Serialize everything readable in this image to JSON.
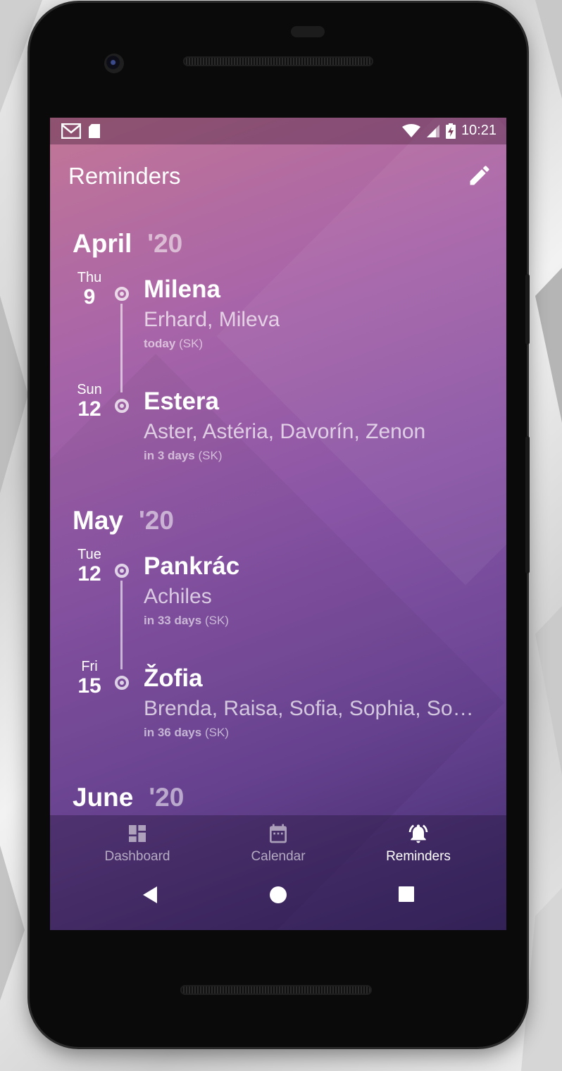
{
  "statusbar": {
    "time": "10:21",
    "left_icons": [
      "gmail-icon",
      "sd-card-icon"
    ],
    "right_icons": [
      "wifi-icon",
      "signal-icon",
      "battery-charging-icon"
    ]
  },
  "appbar": {
    "title": "Reminders",
    "action_icon": "edit-pencil-icon"
  },
  "months": [
    {
      "name": "April",
      "year": "'20",
      "entries": [
        {
          "dow": "Thu",
          "day": "9",
          "name": "Milena",
          "others": "Erhard, Mileva",
          "when_bold": "today",
          "when_suffix": " (SK)"
        },
        {
          "dow": "Sun",
          "day": "12",
          "name": "Estera",
          "others": "Aster, Astéria, Davorín, Zenon",
          "when_bold": "in 3 days",
          "when_suffix": " (SK)"
        }
      ]
    },
    {
      "name": "May",
      "year": "'20",
      "entries": [
        {
          "dow": "Tue",
          "day": "12",
          "name": "Pankrác",
          "others": "Achiles",
          "when_bold": "in 33 days",
          "when_suffix": " (SK)"
        },
        {
          "dow": "Fri",
          "day": "15",
          "name": "Žofia",
          "others": "Brenda, Raisa, Sofia, Sophia, Sop…",
          "when_bold": "in 36 days",
          "when_suffix": " (SK)"
        }
      ]
    },
    {
      "name": "June",
      "year": "'20",
      "entries": []
    }
  ],
  "bottom_nav": {
    "items": [
      {
        "label": "Dashboard",
        "icon": "dashboard-icon",
        "active": false
      },
      {
        "label": "Calendar",
        "icon": "calendar-icon",
        "active": false
      },
      {
        "label": "Reminders",
        "icon": "bell-ringing-icon",
        "active": true
      }
    ]
  },
  "system_nav": [
    "back-icon",
    "home-icon",
    "recents-icon"
  ],
  "colors": {
    "gradient_top": "#c27696",
    "gradient_bottom": "#3d2a6a",
    "text": "#ffffff"
  }
}
